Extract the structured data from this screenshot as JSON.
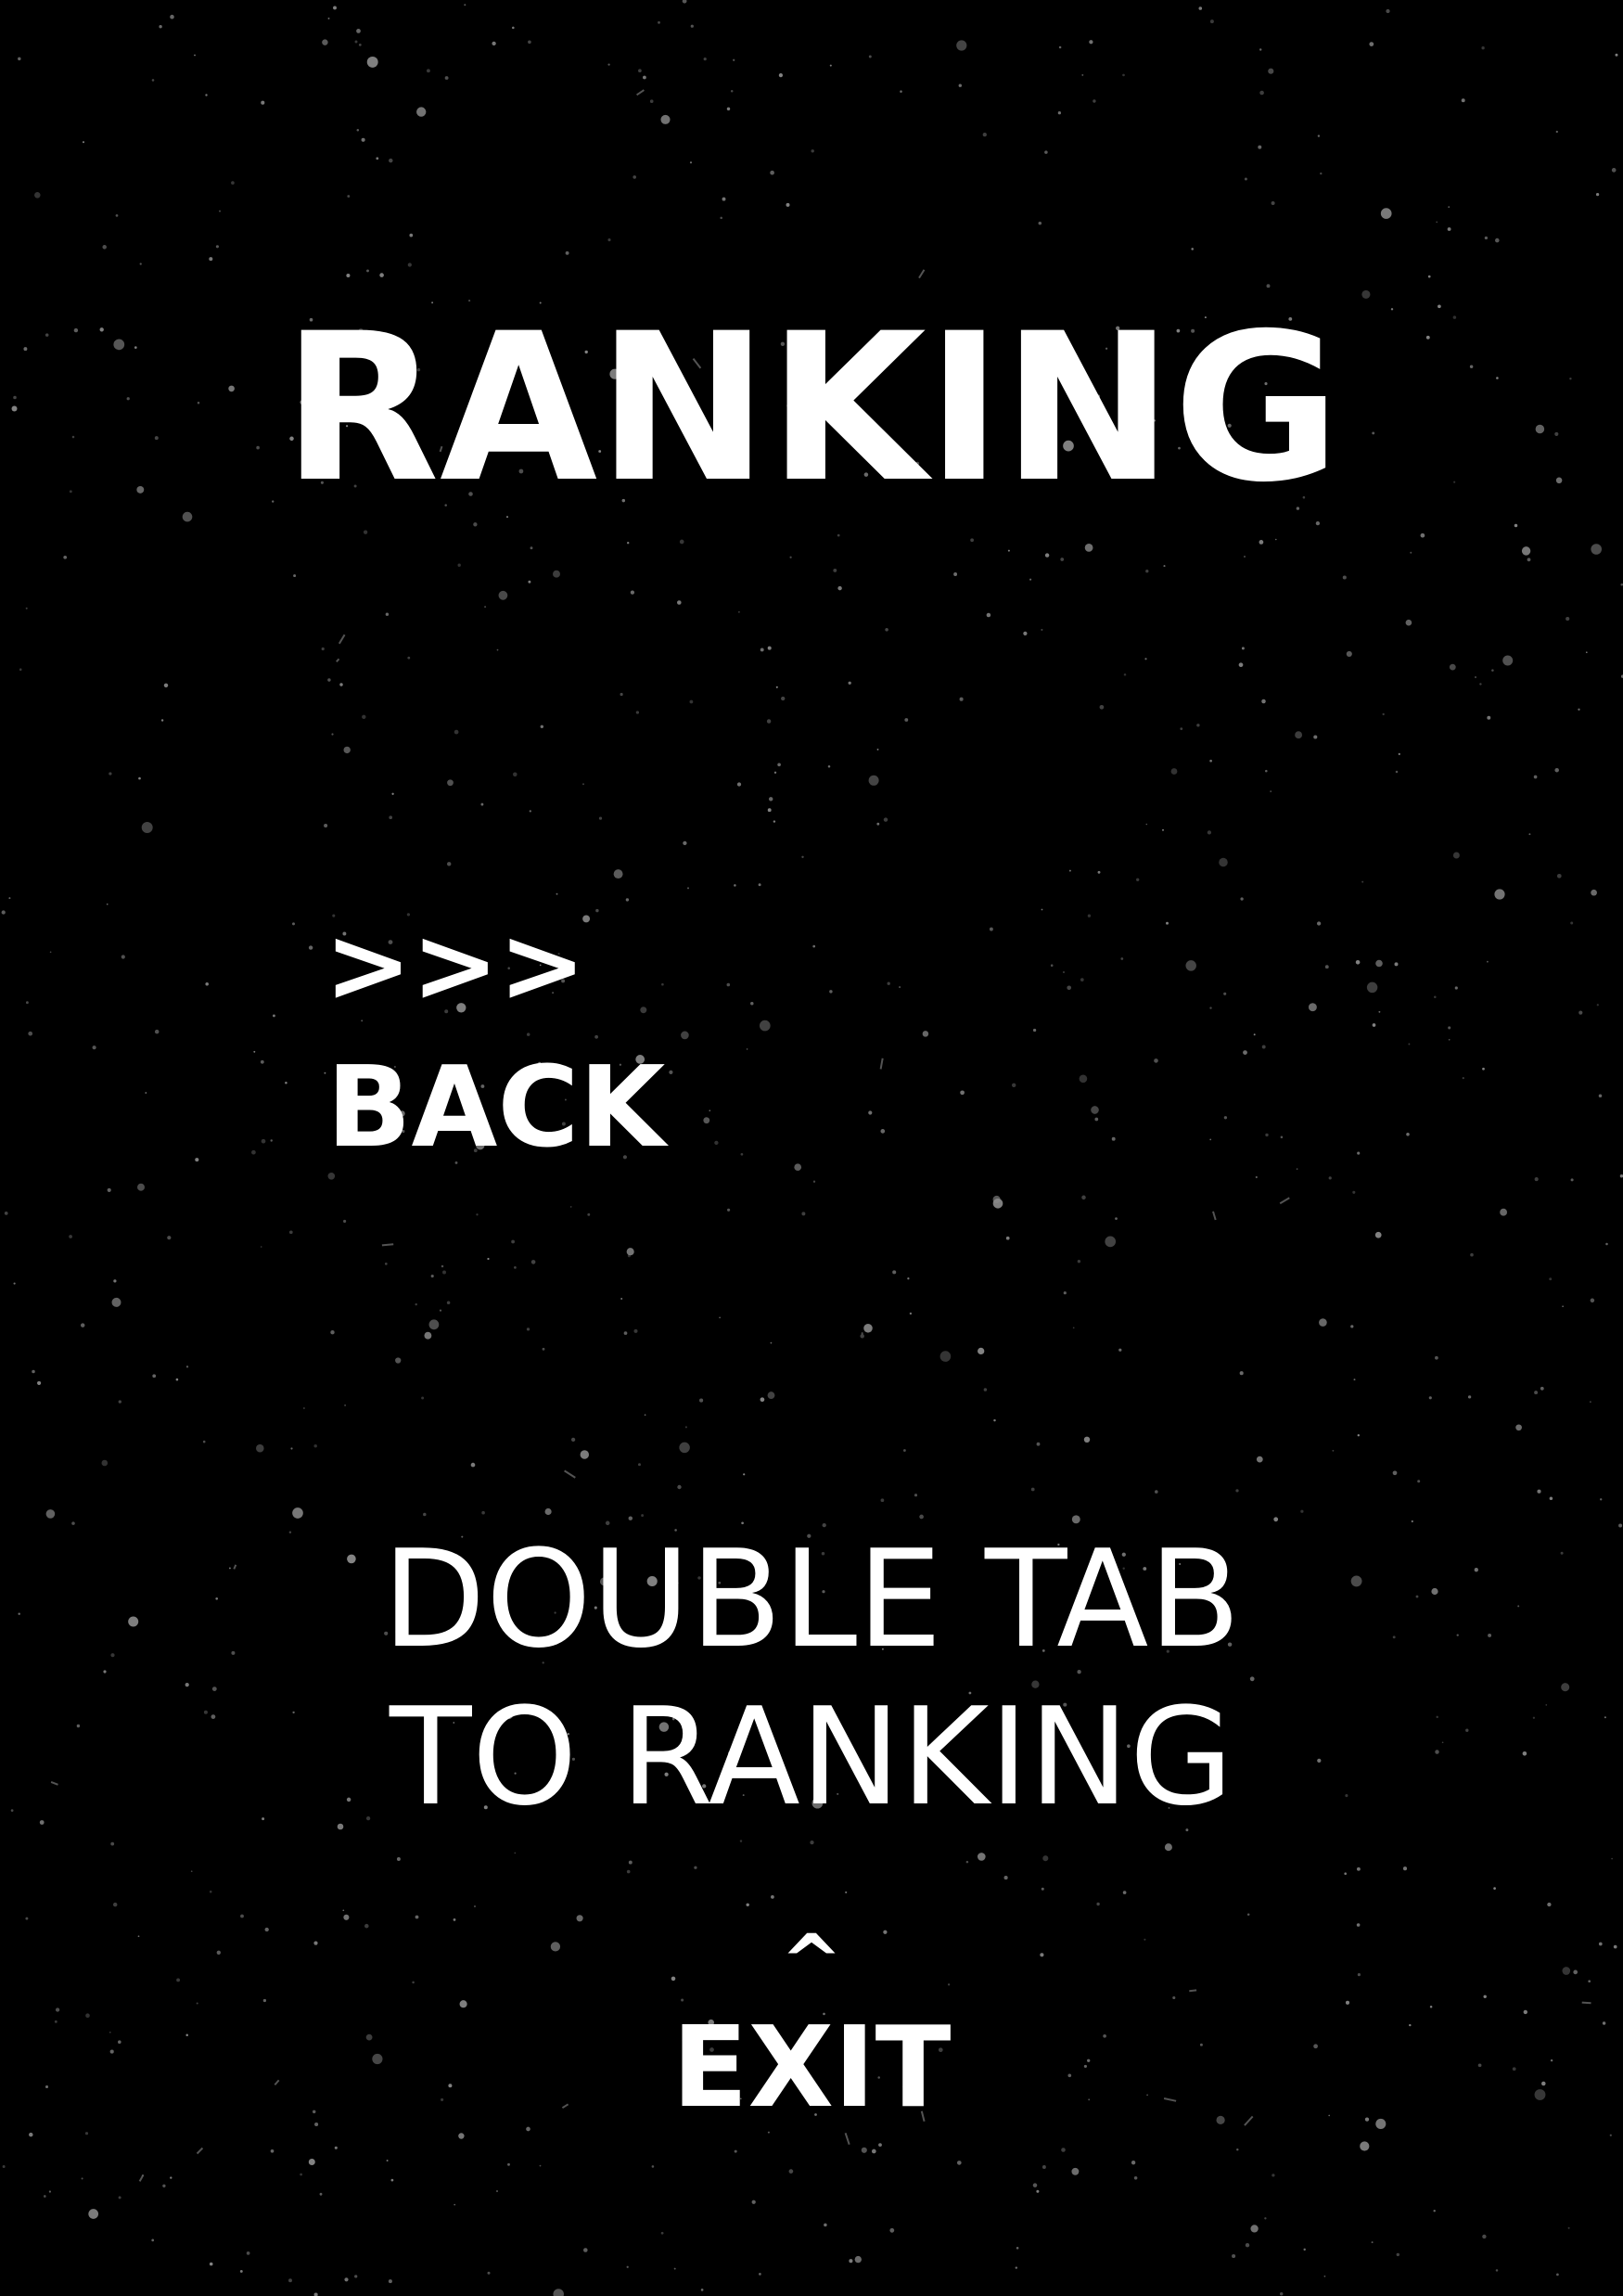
{
  "screen": {
    "background_color": "#000000",
    "star_color": "#8a8a8a",
    "text_color": "#ffffff"
  },
  "title": "RANKING",
  "back": {
    "arrows": ">>>",
    "label": "BACK"
  },
  "hint": {
    "line1": "DOUBLE TAB",
    "line2": "TO RANKING"
  },
  "exit": {
    "caret": "^",
    "label": "EXIT"
  }
}
